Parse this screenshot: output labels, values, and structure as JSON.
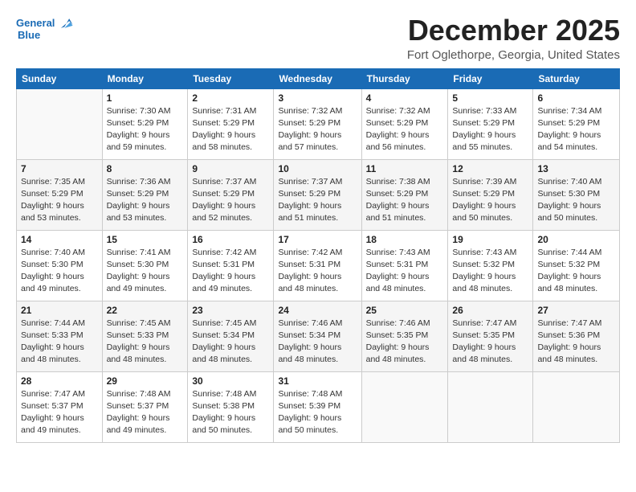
{
  "header": {
    "logo_line1": "General",
    "logo_line2": "Blue",
    "month": "December 2025",
    "location": "Fort Oglethorpe, Georgia, United States"
  },
  "weekdays": [
    "Sunday",
    "Monday",
    "Tuesday",
    "Wednesday",
    "Thursday",
    "Friday",
    "Saturday"
  ],
  "weeks": [
    [
      {
        "num": "",
        "detail": ""
      },
      {
        "num": "1",
        "detail": "Sunrise: 7:30 AM\nSunset: 5:29 PM\nDaylight: 9 hours\nand 59 minutes."
      },
      {
        "num": "2",
        "detail": "Sunrise: 7:31 AM\nSunset: 5:29 PM\nDaylight: 9 hours\nand 58 minutes."
      },
      {
        "num": "3",
        "detail": "Sunrise: 7:32 AM\nSunset: 5:29 PM\nDaylight: 9 hours\nand 57 minutes."
      },
      {
        "num": "4",
        "detail": "Sunrise: 7:32 AM\nSunset: 5:29 PM\nDaylight: 9 hours\nand 56 minutes."
      },
      {
        "num": "5",
        "detail": "Sunrise: 7:33 AM\nSunset: 5:29 PM\nDaylight: 9 hours\nand 55 minutes."
      },
      {
        "num": "6",
        "detail": "Sunrise: 7:34 AM\nSunset: 5:29 PM\nDaylight: 9 hours\nand 54 minutes."
      }
    ],
    [
      {
        "num": "7",
        "detail": "Sunrise: 7:35 AM\nSunset: 5:29 PM\nDaylight: 9 hours\nand 53 minutes."
      },
      {
        "num": "8",
        "detail": "Sunrise: 7:36 AM\nSunset: 5:29 PM\nDaylight: 9 hours\nand 53 minutes."
      },
      {
        "num": "9",
        "detail": "Sunrise: 7:37 AM\nSunset: 5:29 PM\nDaylight: 9 hours\nand 52 minutes."
      },
      {
        "num": "10",
        "detail": "Sunrise: 7:37 AM\nSunset: 5:29 PM\nDaylight: 9 hours\nand 51 minutes."
      },
      {
        "num": "11",
        "detail": "Sunrise: 7:38 AM\nSunset: 5:29 PM\nDaylight: 9 hours\nand 51 minutes."
      },
      {
        "num": "12",
        "detail": "Sunrise: 7:39 AM\nSunset: 5:29 PM\nDaylight: 9 hours\nand 50 minutes."
      },
      {
        "num": "13",
        "detail": "Sunrise: 7:40 AM\nSunset: 5:30 PM\nDaylight: 9 hours\nand 50 minutes."
      }
    ],
    [
      {
        "num": "14",
        "detail": "Sunrise: 7:40 AM\nSunset: 5:30 PM\nDaylight: 9 hours\nand 49 minutes."
      },
      {
        "num": "15",
        "detail": "Sunrise: 7:41 AM\nSunset: 5:30 PM\nDaylight: 9 hours\nand 49 minutes."
      },
      {
        "num": "16",
        "detail": "Sunrise: 7:42 AM\nSunset: 5:31 PM\nDaylight: 9 hours\nand 49 minutes."
      },
      {
        "num": "17",
        "detail": "Sunrise: 7:42 AM\nSunset: 5:31 PM\nDaylight: 9 hours\nand 48 minutes."
      },
      {
        "num": "18",
        "detail": "Sunrise: 7:43 AM\nSunset: 5:31 PM\nDaylight: 9 hours\nand 48 minutes."
      },
      {
        "num": "19",
        "detail": "Sunrise: 7:43 AM\nSunset: 5:32 PM\nDaylight: 9 hours\nand 48 minutes."
      },
      {
        "num": "20",
        "detail": "Sunrise: 7:44 AM\nSunset: 5:32 PM\nDaylight: 9 hours\nand 48 minutes."
      }
    ],
    [
      {
        "num": "21",
        "detail": "Sunrise: 7:44 AM\nSunset: 5:33 PM\nDaylight: 9 hours\nand 48 minutes."
      },
      {
        "num": "22",
        "detail": "Sunrise: 7:45 AM\nSunset: 5:33 PM\nDaylight: 9 hours\nand 48 minutes."
      },
      {
        "num": "23",
        "detail": "Sunrise: 7:45 AM\nSunset: 5:34 PM\nDaylight: 9 hours\nand 48 minutes."
      },
      {
        "num": "24",
        "detail": "Sunrise: 7:46 AM\nSunset: 5:34 PM\nDaylight: 9 hours\nand 48 minutes."
      },
      {
        "num": "25",
        "detail": "Sunrise: 7:46 AM\nSunset: 5:35 PM\nDaylight: 9 hours\nand 48 minutes."
      },
      {
        "num": "26",
        "detail": "Sunrise: 7:47 AM\nSunset: 5:35 PM\nDaylight: 9 hours\nand 48 minutes."
      },
      {
        "num": "27",
        "detail": "Sunrise: 7:47 AM\nSunset: 5:36 PM\nDaylight: 9 hours\nand 48 minutes."
      }
    ],
    [
      {
        "num": "28",
        "detail": "Sunrise: 7:47 AM\nSunset: 5:37 PM\nDaylight: 9 hours\nand 49 minutes."
      },
      {
        "num": "29",
        "detail": "Sunrise: 7:48 AM\nSunset: 5:37 PM\nDaylight: 9 hours\nand 49 minutes."
      },
      {
        "num": "30",
        "detail": "Sunrise: 7:48 AM\nSunset: 5:38 PM\nDaylight: 9 hours\nand 50 minutes."
      },
      {
        "num": "31",
        "detail": "Sunrise: 7:48 AM\nSunset: 5:39 PM\nDaylight: 9 hours\nand 50 minutes."
      },
      {
        "num": "",
        "detail": ""
      },
      {
        "num": "",
        "detail": ""
      },
      {
        "num": "",
        "detail": ""
      }
    ]
  ]
}
